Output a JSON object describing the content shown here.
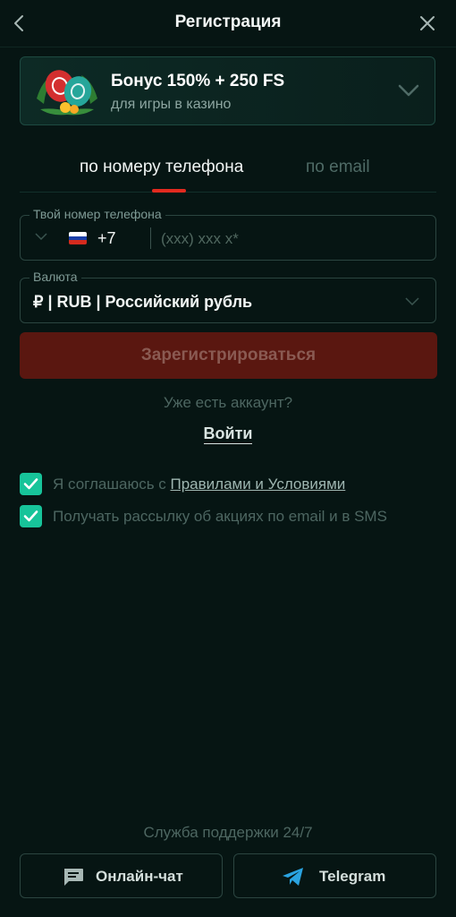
{
  "header": {
    "title": "Регистрация"
  },
  "bonus": {
    "title": "Бонус 150% + 250 FS",
    "subtitle": "для игры в казино"
  },
  "tabs": [
    {
      "label": "по номеру телефона",
      "active": true
    },
    {
      "label": "по email",
      "active": false
    }
  ],
  "phone": {
    "label": "Твой номер телефона",
    "code": "+7",
    "placeholder": "(xxx) xxx x*"
  },
  "currency": {
    "label": "Валюта",
    "value": "₽ | RUB | Российский рубль"
  },
  "submit_label": "Зарегистрироваться",
  "login": {
    "question": "Уже есть аккаунт?",
    "link": "Войти"
  },
  "agreements": {
    "terms_prefix": "Я соглашаюсь с ",
    "terms_link": "Правилами и Условиями",
    "newsletter": "Получать рассылку об акциях по email и в SMS"
  },
  "support": {
    "title": "Служба поддержки 24/7",
    "chat_label": "Онлайн-чат",
    "telegram_label": "Telegram"
  },
  "colors": {
    "accent": "#e22a1f",
    "checkbox": "#17c49a",
    "telegram": "#2aa3e0"
  }
}
